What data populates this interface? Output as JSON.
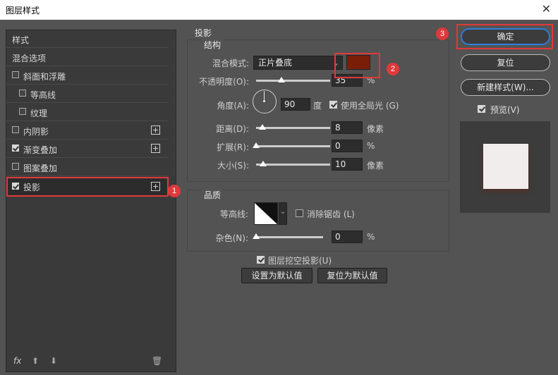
{
  "window": {
    "title": "图层样式",
    "close_icon": "close-icon"
  },
  "left_panel": {
    "header_styles": "样式",
    "header_blend": "混合选项",
    "items": [
      {
        "label": "斜面和浮雕",
        "checked": false
      },
      {
        "label": "等高线",
        "checked": false
      },
      {
        "label": "纹理",
        "checked": false
      },
      {
        "label": "内阴影",
        "checked": false,
        "plus": "+"
      },
      {
        "label": "渐变叠加",
        "checked": true,
        "plus": "+"
      },
      {
        "label": "图案叠加",
        "checked": false
      },
      {
        "label": "投影",
        "checked": true,
        "plus": "+"
      }
    ],
    "footer_fx": "fx",
    "footer_up": "⬆",
    "footer_down": "⬇",
    "footer_trash": "🗑"
  },
  "badges": {
    "one": "1",
    "two": "2",
    "three": "3"
  },
  "drop_shadow": {
    "title": "投影",
    "structure": {
      "title": "结构",
      "blend_mode_label": "混合模式:",
      "blend_mode_value": "正片叠底",
      "color": "#7a1e08",
      "opacity_label": "不透明度(O):",
      "opacity_value": "35",
      "opacity_unit": "%",
      "opacity_fraction": 0.35,
      "angle_label": "角度(A):",
      "angle_value": "90",
      "angle_unit": "度",
      "global_light_label": "使用全局光 (G)",
      "global_light_checked": true,
      "distance_label": "距离(D):",
      "distance_value": "8",
      "distance_unit": "像素",
      "spread_label": "扩展(R):",
      "spread_value": "0",
      "spread_unit": "%",
      "size_label": "大小(S):",
      "size_value": "10",
      "size_unit": "像素"
    },
    "quality": {
      "title": "品质",
      "contour_label": "等高线:",
      "antialias_label": "消除锯齿 (L)",
      "noise_label": "杂色(N):",
      "noise_value": "0",
      "noise_unit": "%"
    },
    "knockout_label": "图层挖空投影(U)",
    "set_default": "设置为默认值",
    "reset_default": "复位为默认值"
  },
  "right_panel": {
    "ok": "确定",
    "reset": "复位",
    "new_style": "新建样式(W)...",
    "preview_label": "预览(V)",
    "preview_checked": true
  },
  "colors": {
    "accent_red": "#e0393b",
    "focus_blue": "#2f7fe0"
  }
}
